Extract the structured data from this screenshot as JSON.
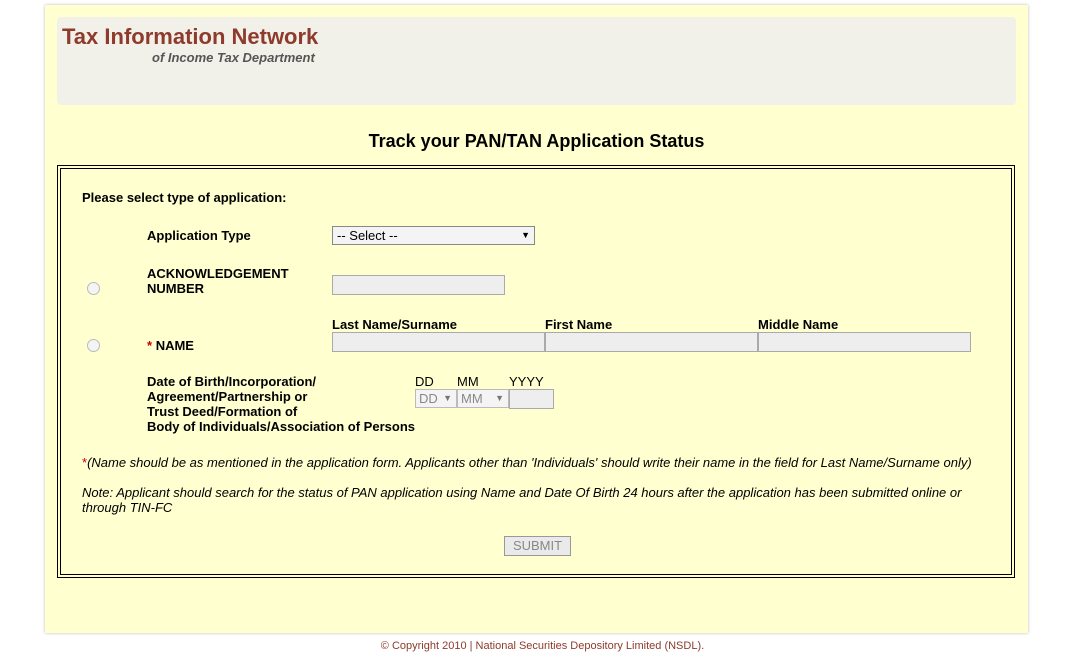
{
  "brand": {
    "title": "Tax Information Network",
    "subtitle": "of Income Tax Department"
  },
  "page": {
    "title": "Track your PAN/TAN Application Status"
  },
  "form": {
    "section_label": "Please select type of application:",
    "application_type_label": "Application Type",
    "application_type_value": "-- Select --",
    "ack_label_line1": "ACKNOWLEDGEMENT",
    "ack_label_line2": "NUMBER",
    "required_marker": "*",
    "name_label": "NAME",
    "last_name_header": "Last Name/Surname",
    "first_name_header": "First Name",
    "middle_name_header": "Middle Name",
    "dob_label_lines": [
      "Date of Birth/Incorporation/",
      "Agreement/Partnership or",
      "Trust Deed/Formation of",
      "Body of Individuals/Association of Persons"
    ],
    "dd_header": "DD",
    "mm_header": "MM",
    "yyyy_header": "YYYY",
    "dd_value": "DD",
    "mm_value": "MM",
    "name_note": "(Name should be as mentioned in the application form. Applicants other than 'Individuals' should write their name in the field for Last Name/Surname only)",
    "search_note_line1": "Note: Applicant should search for the status of PAN application using Name and Date Of Birth 24 hours after the application has been submitted online or",
    "search_note_line2": "through TIN-FC",
    "submit_label": "SUBMIT"
  },
  "footer": {
    "copyright": "© Copyright 2010  |  National Securities Depository Limited (NSDL)."
  },
  "colors": {
    "brand": "#8e3a2c",
    "background": "#ffffd0",
    "required": "#cc0000"
  },
  "icons": {
    "dropdown": "dropdown-arrow-icon"
  }
}
